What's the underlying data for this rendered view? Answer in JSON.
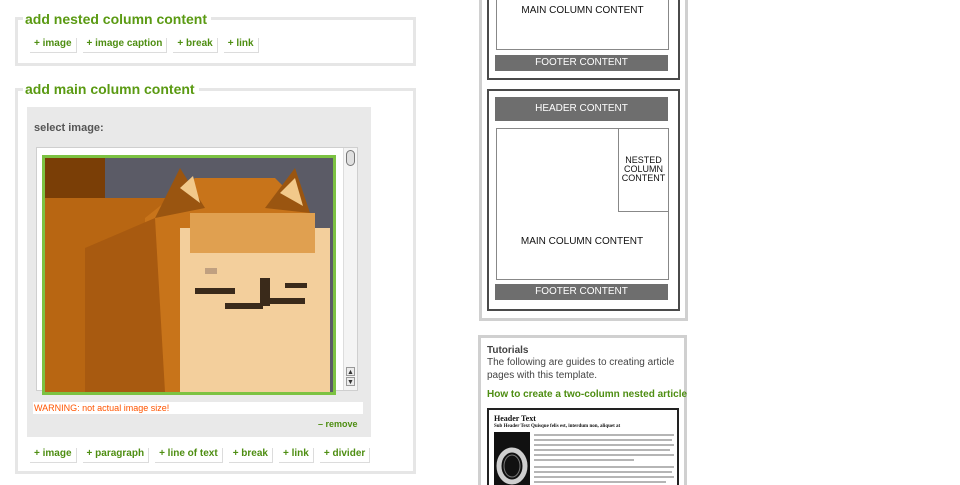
{
  "nested_panel": {
    "title": "add nested column content",
    "buttons": [
      "+ image",
      "+ image caption",
      "+ break",
      "+ link"
    ]
  },
  "main_panel": {
    "title": "add main column content",
    "select_label": "select image:",
    "warning": "WARNING: not actual image size!",
    "remove_label": "– remove",
    "buttons": [
      "+ image",
      "+ paragraph",
      "+ line of text",
      "+ break",
      "+ link",
      "+ divider"
    ]
  },
  "layout_diagram": {
    "first": {
      "main": "MAIN COLUMN CONTENT",
      "footer": "FOOTER CONTENT"
    },
    "second": {
      "header": "HEADER CONTENT",
      "nested": "NESTED COLUMN CONTENT",
      "main": "MAIN COLUMN CONTENT",
      "footer": "FOOTER CONTENT"
    }
  },
  "tutorials": {
    "title": "Tutorials",
    "description": "The following are guides to creating article pages with this template.",
    "link": "How to create a two-column nested article",
    "thumbnail": {
      "header": "Header Text",
      "subheader": "Sub Header Text Quisque felis est, interdum non, aliquet at"
    }
  },
  "colors": {
    "accent_green": "#5a9a12",
    "warning_orange": "#ff5500",
    "image_border": "#7cc242",
    "diagram_bar": "#6e6e6e"
  },
  "icons": {
    "scroll_up": "scroll-up-arrow-icon",
    "scroll_down": "scroll-down-arrow-icon"
  }
}
